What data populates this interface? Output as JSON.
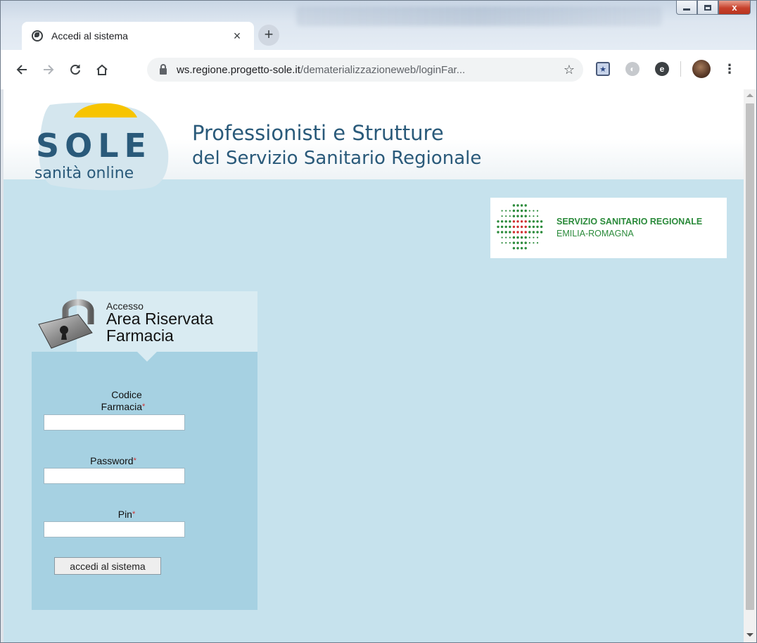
{
  "browser": {
    "tab_title": "Accedi al sistema",
    "tab_close": "×",
    "new_tab": "+",
    "url_host": "ws.regione.progetto-sole.it",
    "url_path": "/dematerializzazioneweb/loginFar...",
    "icons": [
      "globe-icon",
      "back-icon",
      "forward-icon",
      "reload-icon",
      "home-icon",
      "lock-icon",
      "star-icon",
      "bookmark-extension-icon",
      "globe-extension-icon",
      "c-extension-icon",
      "avatar",
      "menu-dots-icon"
    ]
  },
  "window_controls": {
    "close": "x"
  },
  "header": {
    "logo_word": "SOLE",
    "logo_sub": "sanità online",
    "title_line1": "Professionisti e Strutture",
    "title_line2": "del Servizio Sanitario Regionale"
  },
  "ssr": {
    "line1": "SERVIZIO SANITARIO REGIONALE",
    "line2": "EMILIA-ROMAGNA",
    "colors": {
      "green": "#2a8a3a",
      "red": "#d03030"
    }
  },
  "login": {
    "small": "Accesso",
    "title_line1": "Area Riservata",
    "title_line2": "Farmacia",
    "codice_line1": "Codice",
    "codice_line2": "Farmacia",
    "codice_value": "",
    "password_label": "Password",
    "password_value": "",
    "pin_label": "Pin",
    "pin_value": "",
    "required_mark": "*",
    "submit": "accedi al sistema"
  }
}
